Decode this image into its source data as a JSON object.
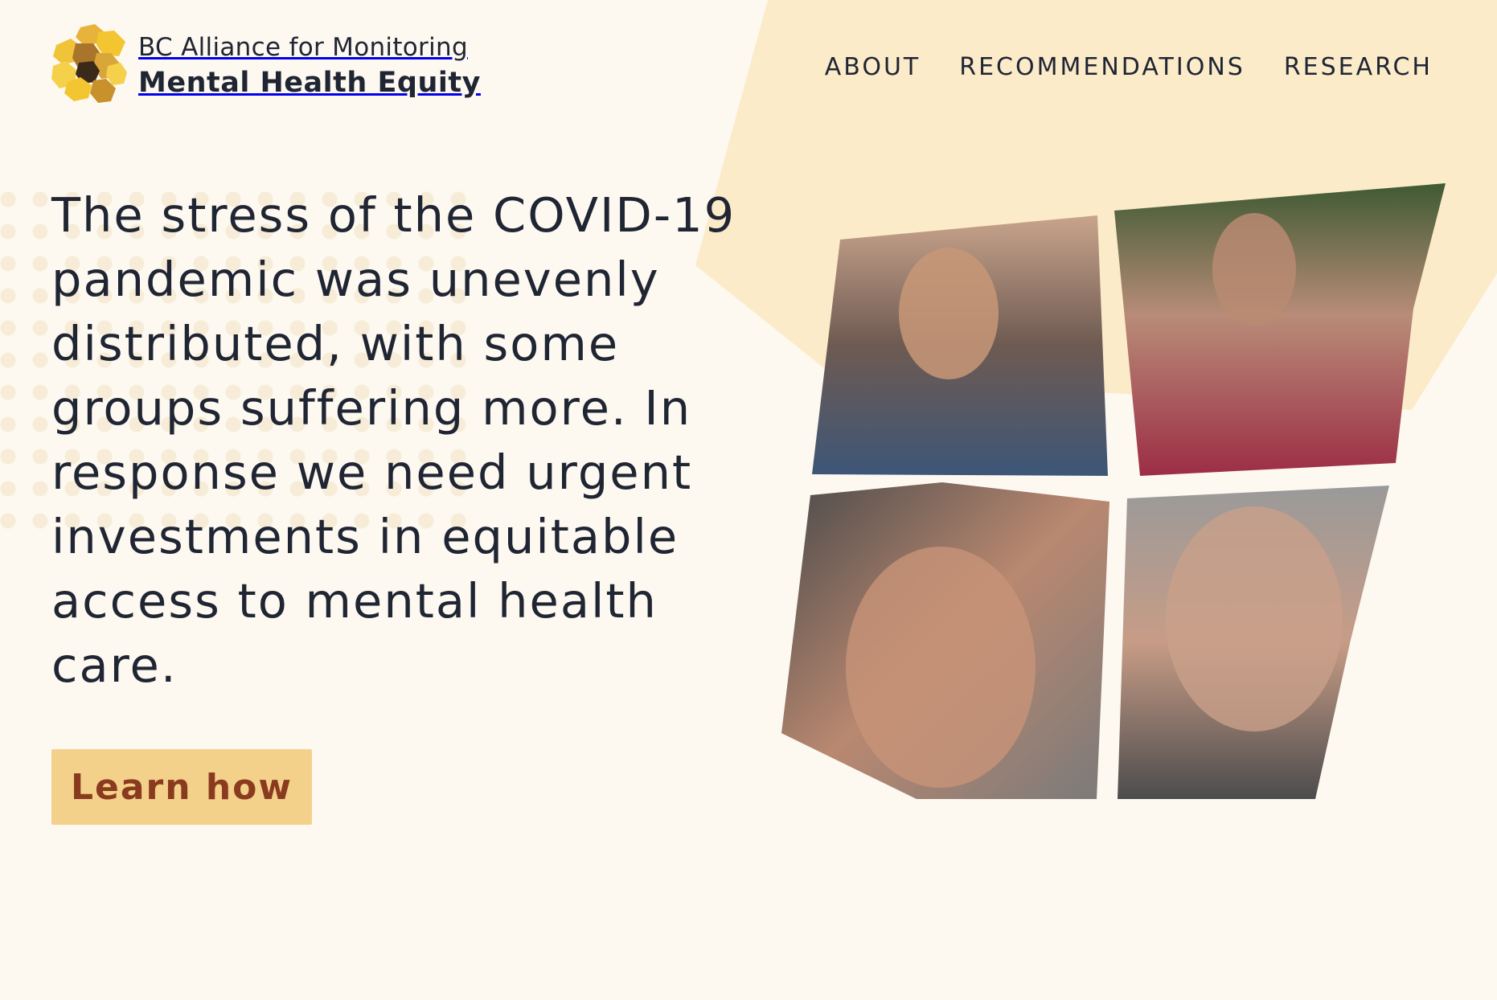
{
  "brand": {
    "line1": "BC Alliance for Monitoring",
    "line2": "Mental Health Equity",
    "logo_icon": "honeycomb-logo-icon",
    "colors": {
      "gold": "#f2c531",
      "amber": "#c9912c",
      "dark": "#3b2a1a"
    }
  },
  "nav": {
    "items": [
      {
        "label": "ABOUT"
      },
      {
        "label": "RECOMMENDATIONS"
      },
      {
        "label": "RESEARCH"
      }
    ]
  },
  "hero": {
    "headline": "The stress of the COVID-19 pandemic was unevenly distributed, with some groups suffering more. In response we need urgent investments in equitable access to mental health care.",
    "cta_label": "Learn how"
  },
  "colors": {
    "background": "#fdf9f0",
    "accent_shape": "#fbebc9",
    "button_bg": "#f3d18a",
    "button_text": "#8a3a1f",
    "text": "#1f2533"
  }
}
